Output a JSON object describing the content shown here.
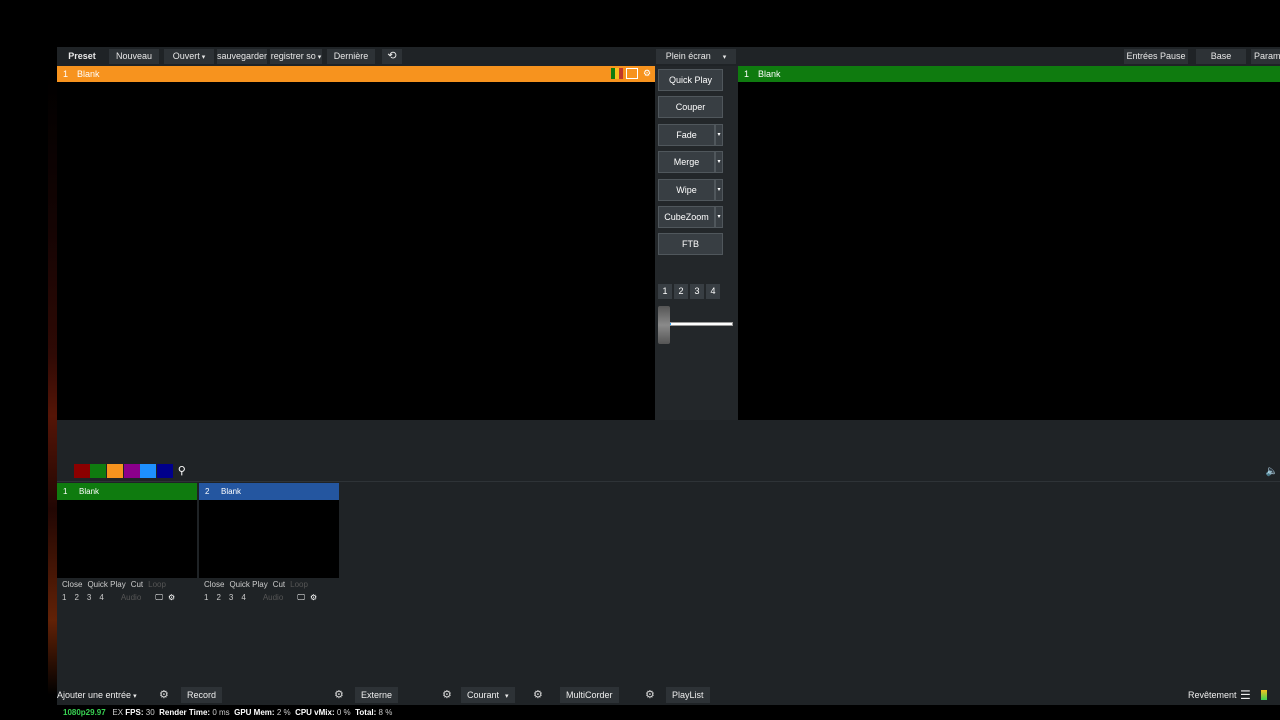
{
  "topbar": {
    "preset": "Preset",
    "nouveau": "Nouveau",
    "ouvert": "Ouvert",
    "sauvegarder": "sauvegarder",
    "registrer": "registrer so",
    "derniere": "Dernière",
    "plein_ecran": "Plein écran",
    "entrees_pause": "Entrées Pause",
    "base": "Base",
    "param": "Param"
  },
  "preview": {
    "num": "1",
    "title": "Blank",
    "color": "#f7931e"
  },
  "output": {
    "num": "1",
    "title": "Blank",
    "color": "#0f7b0f"
  },
  "transitions": {
    "quick_play": "Quick Play",
    "couper": "Couper",
    "fade": "Fade",
    "merge": "Merge",
    "wipe": "Wipe",
    "cubezoom": "CubeZoom",
    "ftb": "FTB",
    "numbers": [
      "1",
      "2",
      "3",
      "4"
    ],
    "tbar_position": 0.1
  },
  "swatches": [
    "#1f2326",
    "#8b0000",
    "#0f7b0f",
    "#f7931e",
    "#8b008b",
    "#1e90ff",
    "#00008b"
  ],
  "inputs": [
    {
      "num": "1",
      "title": "Blank",
      "color": "#0f7b0f",
      "close": "Close",
      "quick_play": "Quick Play",
      "cut": "Cut",
      "loop": "Loop",
      "numbers": [
        "1",
        "2",
        "3",
        "4"
      ],
      "audio": "Audio"
    },
    {
      "num": "2",
      "title": "Blank",
      "color": "#2456a0",
      "close": "Close",
      "quick_play": "Quick Play",
      "cut": "Cut",
      "loop": "Loop",
      "numbers": [
        "1",
        "2",
        "3",
        "4"
      ],
      "audio": "Audio"
    }
  ],
  "bottombar": {
    "ajouter": "Ajouter une entrée",
    "record": "Record",
    "externe": "Externe",
    "courant": "Courant",
    "multicorder": "MultiCorder",
    "playlist": "PlayList",
    "revetement": "Revêtement"
  },
  "status": {
    "format": "1080p29.97",
    "ex": "EX",
    "fps_label": "FPS:",
    "fps": "30",
    "render_label": "Render Time:",
    "render": "0 ms",
    "gpu_label": "GPU Mem:",
    "gpu": "2 %",
    "cpu_label": "CPU vMix:",
    "cpu": "0 %",
    "total_label": "Total:",
    "total": "8 %"
  }
}
